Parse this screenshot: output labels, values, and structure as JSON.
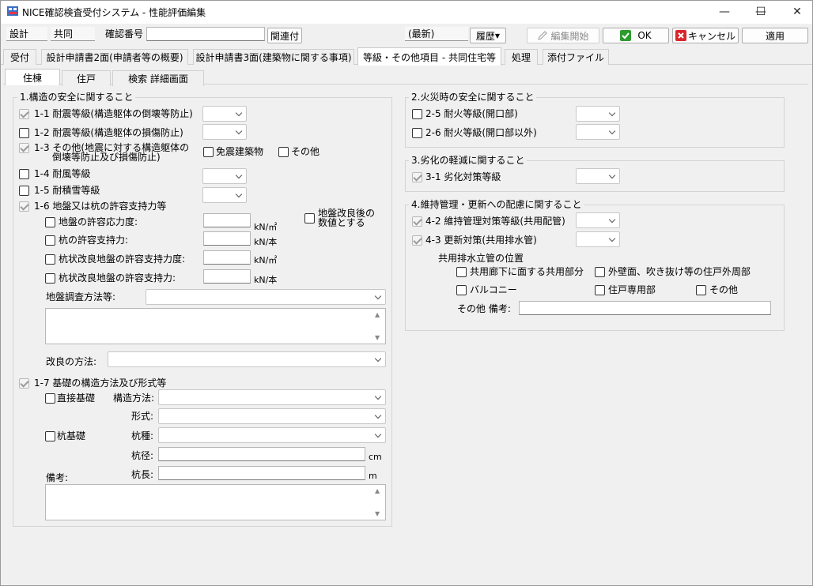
{
  "window": {
    "title": "NICE確認検査受付システム - 性能評価編集",
    "controls": [
      "—",
      "☐",
      "✕"
    ]
  },
  "toolbar": {
    "field1": "設計",
    "field2": "共同",
    "kakunin_label": "確認番号",
    "kakunin_value": "",
    "kanren_button": "関連付",
    "latest": "(最新)",
    "history_button": "履歴",
    "edit_start_button": "編集開始",
    "ok_button": "OK",
    "cancel_button": "キャンセル",
    "apply_button": "適用"
  },
  "main_tabs": [
    "受付",
    "設計申請書2面(申請者等の概要)",
    "設計申請書3面(建築物に関する事項)",
    "等級・その他項目 - 共同住宅等",
    "処理",
    "添付ファイル"
  ],
  "sub_tabs": [
    "住棟",
    "住戸",
    "検索 詳細画面"
  ],
  "section1": {
    "title": "1.構造の安全に関すること",
    "items": [
      {
        "label": "1-1 耐震等級(構造躯体の倒壊等防止)",
        "checked": true
      },
      {
        "label": "1-2 耐震等級(構造躯体の損傷防止)",
        "checked": false
      },
      {
        "label_line1": "1-3 その他(地震に対する構造躯体の",
        "label_line2": "倒壊等防止及び損傷防止)",
        "checked": true
      },
      {
        "label": "1-4 耐風等級",
        "checked": false
      },
      {
        "label": "1-5 耐積雪等級",
        "checked": false
      },
      {
        "label": "1-6 地盤又は杭の許容支持力等",
        "checked": true
      }
    ],
    "menshin": "免震建築物",
    "sonota": "その他",
    "jiban": {
      "rows": [
        {
          "label": "地盤の許容応力度:",
          "unit": "kN/㎡"
        },
        {
          "label": "杭の許容支持力:",
          "unit": "kN/本"
        },
        {
          "label": "杭状改良地盤の許容支持力度:",
          "unit": "kN/㎡"
        },
        {
          "label": "杭状改良地盤の許容支持力:",
          "unit": "kN/本"
        }
      ],
      "kairyo_line1": "地盤改良後の",
      "kairyo_line2": "数値とする",
      "chosa_label": "地盤調査方法等:",
      "kairyo_houhou_label": "改良の方法:"
    },
    "kiso": {
      "title": "1-7 基礎の構造方法及び形式等",
      "chokusetsu": "直接基礎",
      "kui": "杭基礎",
      "kouzou_houhou": "構造方法:",
      "keishiki": "形式:",
      "kuishu": "杭種:",
      "kuikei": "杭径:",
      "kuikei_unit": "cm",
      "kuichou": "杭長:",
      "kuichou_unit": "m",
      "bikou": "備考:"
    }
  },
  "section2": {
    "title": "2.火災時の安全に関すること",
    "items": [
      "2-5 耐火等級(開口部)",
      "2-6 耐火等級(開口部以外)"
    ]
  },
  "section3": {
    "title": "3.劣化の軽減に関すること",
    "items": [
      "3-1 劣化対策等級"
    ]
  },
  "section4": {
    "title": "4.維持管理・更新への配慮に関すること",
    "items": [
      "4-2 維持管理対策等級(共用配管)",
      "4-3 更新対策(共用排水管)"
    ],
    "position_title": "共用排水立管の位置",
    "options": [
      "共用廊下に面する共用部分",
      "外壁面、吹き抜け等の住戸外周部",
      "バルコニー",
      "住戸専用部",
      "その他"
    ],
    "sonota_bikou": "その他 備考:"
  }
}
